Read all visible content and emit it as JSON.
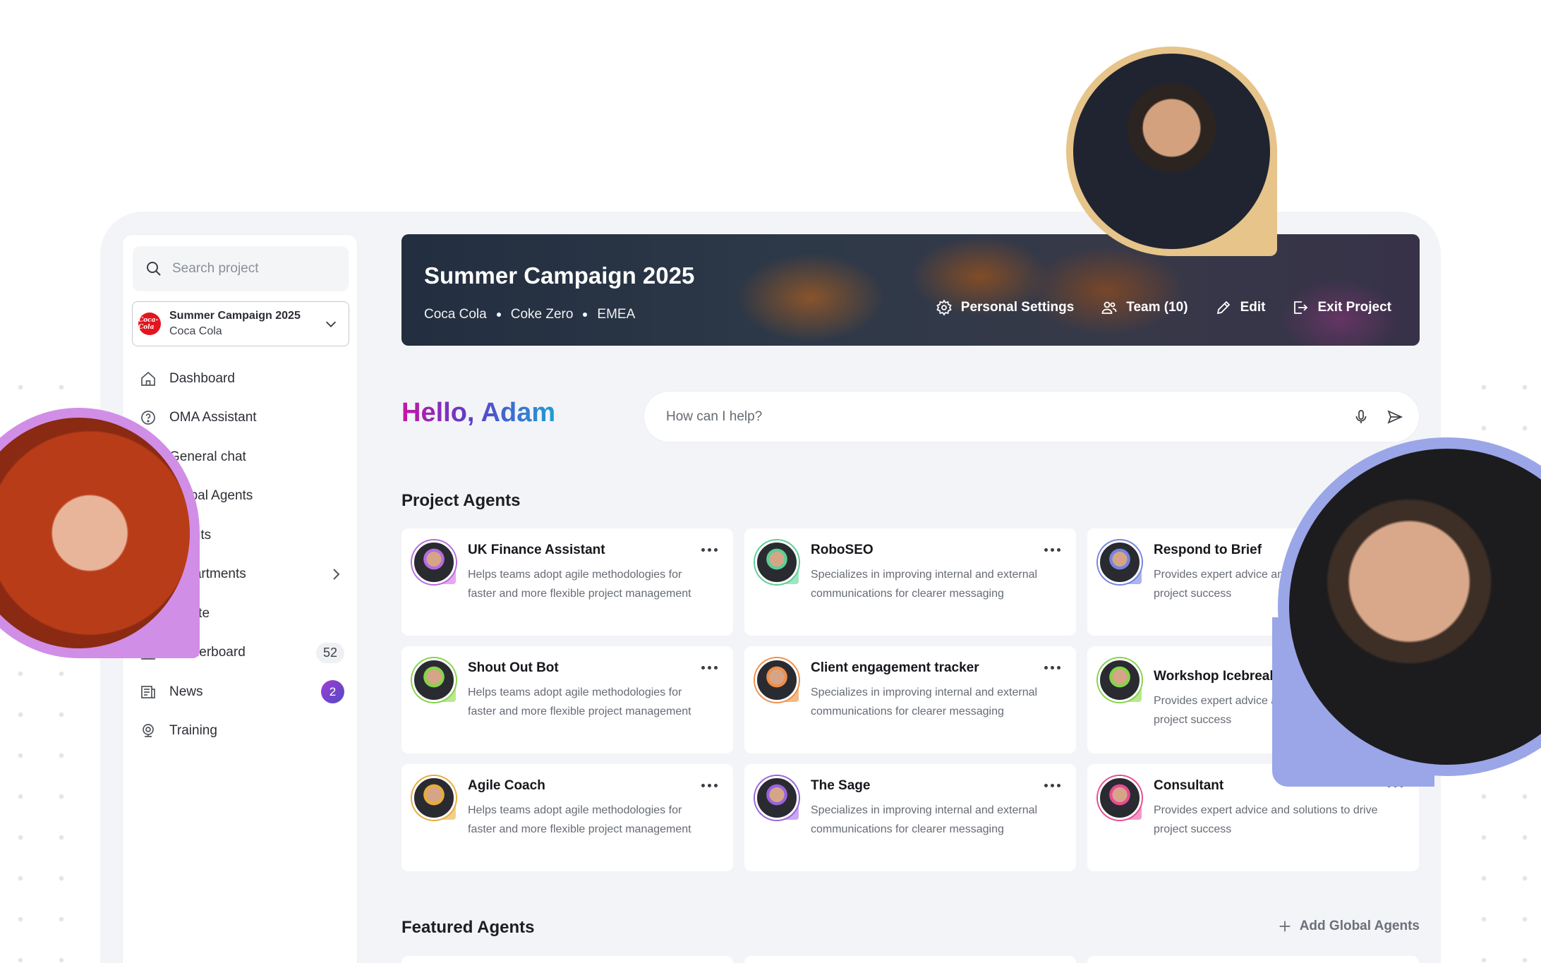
{
  "sidebar": {
    "search_placeholder": "Search project",
    "project": {
      "title": "Summer Campaign 2025",
      "client": "Coca Cola",
      "logo_text": "Coca-Cola"
    },
    "items": [
      {
        "label": "Dashboard",
        "icon": "home-icon"
      },
      {
        "label": "OMA Assistant",
        "icon": "question-circle-icon"
      },
      {
        "label": "General chat",
        "icon": "chat-icon"
      },
      {
        "label": "Global Agents",
        "icon": "globe-icon"
      },
      {
        "label": "Agents",
        "icon": "agents-icon"
      },
      {
        "label": "Departments",
        "icon": "departments-icon"
      },
      {
        "label": "Create",
        "icon": "create-icon"
      },
      {
        "label": "Leaderboard",
        "icon": "leaderboard-icon",
        "count": "52"
      },
      {
        "label": "News",
        "icon": "news-icon",
        "badge": "2"
      },
      {
        "label": "Training",
        "icon": "training-icon"
      }
    ]
  },
  "banner": {
    "title": "Summer Campaign 2025",
    "tags": [
      "Coca Cola",
      "Coke Zero",
      "EMEA"
    ],
    "actions": [
      "Personal Settings",
      "Team (10)",
      "Edit",
      "Exit Project"
    ]
  },
  "greeting": "Hello, Adam",
  "ask": {
    "placeholder": "How can I help?"
  },
  "sections": {
    "project_agents": "Project Agents",
    "featured_agents": "Featured Agents",
    "add_global": "Add Global Agents"
  },
  "agents": [
    {
      "name": "UK Finance Assistant",
      "desc": "Helps teams adopt agile methodologies for faster and more flexible project management",
      "accent": "#e7a7ef",
      "ring": "#b56ce0"
    },
    {
      "name": "RoboSEO",
      "desc": "Specializes in improving internal and external communications for clearer messaging",
      "accent": "#9ee6c0",
      "ring": "#5dcf94"
    },
    {
      "name": "Respond to Brief",
      "desc": "Provides expert advice and solutions to drive project success",
      "accent": "#aab4ef",
      "ring": "#7584df"
    },
    {
      "name": "Shout Out Bot",
      "desc": "Helps teams adopt agile methodologies for faster and more flexible project management",
      "accent": "#b9e98e",
      "ring": "#86d44a"
    },
    {
      "name": "Client engagement tracker",
      "desc": "Specializes in improving internal and external communications for clearer messaging",
      "accent": "#f5b985",
      "ring": "#ef8f4a"
    },
    {
      "name": "Workshop Icebreaker",
      "desc": "Provides expert advice and solutions to drive project success",
      "accent": "#b9e98e",
      "ring": "#86d44a"
    },
    {
      "name": "Agile Coach",
      "desc": "Helps teams adopt agile methodologies for faster and more flexible project management",
      "accent": "#f3cf8b",
      "ring": "#e6ad3c"
    },
    {
      "name": "The Sage",
      "desc": "Specializes in improving internal and external communications for clearer messaging",
      "accent": "#c9a8ef",
      "ring": "#9864dc"
    },
    {
      "name": "Consultant",
      "desc": "Provides expert advice and solutions to drive project success",
      "accent": "#f59ac8",
      "ring": "#e84b95"
    }
  ],
  "colors": {
    "brand_gradient": [
      "#c515a6",
      "#5a40c8",
      "#1f9dd8"
    ],
    "coke_red": "#e4151f"
  }
}
